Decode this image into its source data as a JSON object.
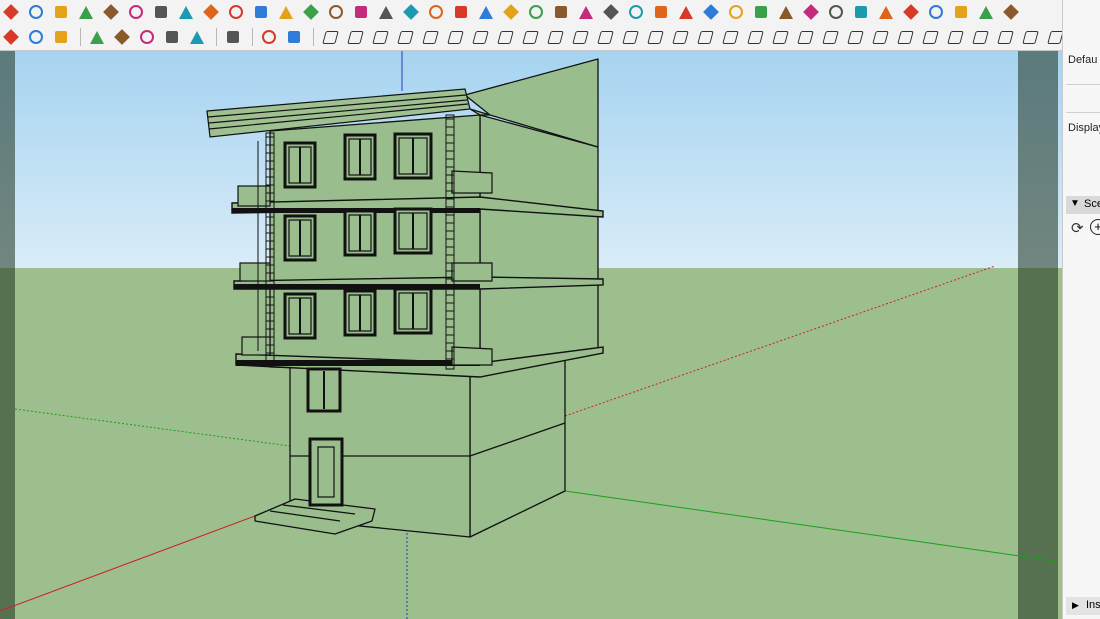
{
  "toolbar_top": {
    "icons": [
      "eraser-icon",
      "paint-bucket-icon",
      "tape-measure-icon",
      "push-pull-icon",
      "follow-me-icon",
      "offset-icon",
      "rotate-icon",
      "scale-icon",
      "line-icon",
      "rectangle-icon",
      "circle-icon",
      "arc-icon",
      "polygon-icon",
      "freehand-icon",
      "move-icon",
      "pan-icon",
      "orbit-icon",
      "zoom-icon",
      "zoom-extents-icon",
      "previous-view-icon",
      "next-view-icon",
      "walk-icon",
      "look-around-icon",
      "section-plane-icon",
      "display-section-icon",
      "text-icon",
      "dimension-icon",
      "protractor-icon",
      "axes-icon",
      "3d-text-icon",
      "sandbox-icon",
      "soften-icon",
      "intersect-icon",
      "union-icon",
      "subtract-icon",
      "trim-icon",
      "split-icon",
      "outer-shell-icon",
      "solid-inspector-icon",
      "components-icon",
      "materials-icon"
    ]
  },
  "toolbar_second": {
    "group_a": [
      "rotate-left-icon",
      "refresh-icon",
      "export-icon"
    ],
    "group_b": [
      "add-location-icon",
      "tree-icon",
      "terrain-icon",
      "checker-icon",
      "cloud-upload-icon"
    ],
    "group_c": [
      "settings-icon"
    ],
    "group_d": [
      "mail-icon",
      "info-icon"
    ],
    "group_e": [
      "extension-tool-1-icon",
      "extension-tool-2-icon",
      "extension-tool-3-icon",
      "extension-tool-4-icon",
      "extension-tool-5-icon",
      "extension-tool-6-icon",
      "extension-tool-7-icon",
      "extension-tool-8-icon",
      "extension-tool-9-icon",
      "extension-tool-10-icon",
      "extension-tool-11-icon",
      "extension-tool-12-icon",
      "extension-tool-13-icon",
      "extension-tool-14-icon",
      "extension-tool-15-icon",
      "extension-tool-16-icon",
      "extension-tool-17-icon",
      "extension-tool-18-icon",
      "extension-tool-19-icon",
      "extension-tool-20-icon",
      "extension-tool-21-icon",
      "extension-tool-22-icon",
      "extension-tool-23-icon",
      "extension-tool-24-icon",
      "extension-tool-25-icon",
      "extension-tool-26-icon",
      "extension-tool-27-icon",
      "extension-tool-28-icon",
      "extension-tool-29-icon",
      "extension-tool-30-icon",
      "extension-tool-31-icon",
      "extension-tool-32-icon"
    ]
  },
  "panel": {
    "default_label": "Defau",
    "display_label": "Display",
    "scenes_label": "Sce",
    "instructor_label": "Ins"
  },
  "colors": {
    "sky_top": "#a6d3f0",
    "ground": "#9cbf8d",
    "axis_red": "#d02020",
    "axis_green": "#1aa01a",
    "axis_blue": "#2040c0"
  }
}
